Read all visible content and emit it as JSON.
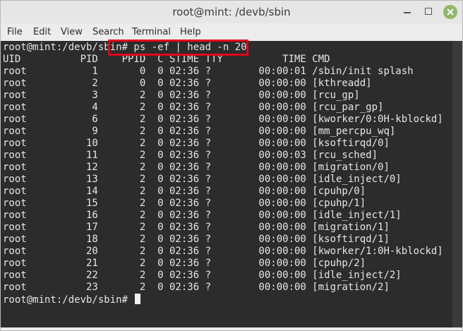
{
  "window": {
    "title": "root@mint: /devb/sbin",
    "close_color": "#8fb768"
  },
  "menu": [
    "File",
    "Edit",
    "View",
    "Search",
    "Terminal",
    "Help"
  ],
  "terminal": {
    "lines": [
      "root@mint:/devb/sbin# ps -ef | head -n 20",
      "UID          PID    PPID  C STIME TTY          TIME CMD",
      "root           1       0  0 02:36 ?        00:00:01 /sbin/init splash",
      "root           2       0  0 02:36 ?        00:00:00 [kthreadd]",
      "root           3       2  0 02:36 ?        00:00:00 [rcu_gp]",
      "root           4       2  0 02:36 ?        00:00:00 [rcu_par_gp]",
      "root           6       2  0 02:36 ?        00:00:00 [kworker/0:0H-kblockd]",
      "root           9       2  0 02:36 ?        00:00:00 [mm_percpu_wq]",
      "root          10       2  0 02:36 ?        00:00:00 [ksoftirqd/0]",
      "root          11       2  0 02:36 ?        00:00:03 [rcu_sched]",
      "root          12       2  0 02:36 ?        00:00:00 [migration/0]",
      "root          13       2  0 02:36 ?        00:00:00 [idle_inject/0]",
      "root          14       2  0 02:36 ?        00:00:00 [cpuhp/0]",
      "root          15       2  0 02:36 ?        00:00:00 [cpuhp/1]",
      "root          16       2  0 02:36 ?        00:00:00 [idle_inject/1]",
      "root          17       2  0 02:36 ?        00:00:00 [migration/1]",
      "root          18       2  0 02:36 ?        00:00:00 [ksoftirqd/1]",
      "root          20       2  0 02:36 ?        00:00:00 [kworker/1:0H-kblockd]",
      "root          21       2  0 02:36 ?        00:00:00 [cpuhp/2]",
      "root          22       2  0 02:36 ?        00:00:00 [idle_inject/2]",
      "root          23       2  0 02:36 ?        00:00:00 [migration/2]"
    ],
    "prompt": "root@mint:/devb/sbin# ",
    "highlight_color": "#e2001a"
  }
}
